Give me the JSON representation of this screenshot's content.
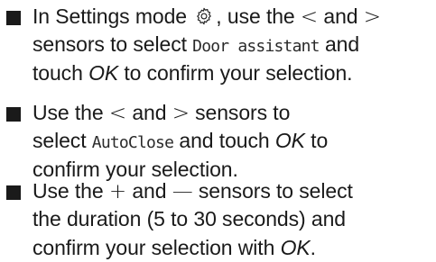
{
  "steps": [
    {
      "lines": [
        {
          "pre": "In Settings mode ",
          "icon": "gear-icon",
          "mid": ", use the ",
          "s1": "<",
          "and": " and ",
          "s2": ">"
        },
        {
          "pre": "sensors to select ",
          "display": "Door assistant",
          "post": " and"
        },
        {
          "pre": "touch ",
          "key": "OK",
          "post": " to confirm your selection."
        }
      ]
    },
    {
      "lines": [
        {
          "pre": "Use the ",
          "s1": "<",
          "and": " and ",
          "s2": ">",
          "post": " sensors to"
        },
        {
          "pre": "select ",
          "display": "AutoClose",
          "mid": " and touch ",
          "key": "OK",
          "post": " to"
        },
        {
          "pre": "confirm your selection."
        }
      ]
    },
    {
      "lines": [
        {
          "pre": "Use the ",
          "s1": "+",
          "and": " and ",
          "s2": "—",
          "post": " sensors to select"
        },
        {
          "pre": "the duration (5 to 30 seconds) and"
        },
        {
          "pre": "confirm your selection with ",
          "key": "OK",
          "post": "."
        }
      ]
    }
  ]
}
